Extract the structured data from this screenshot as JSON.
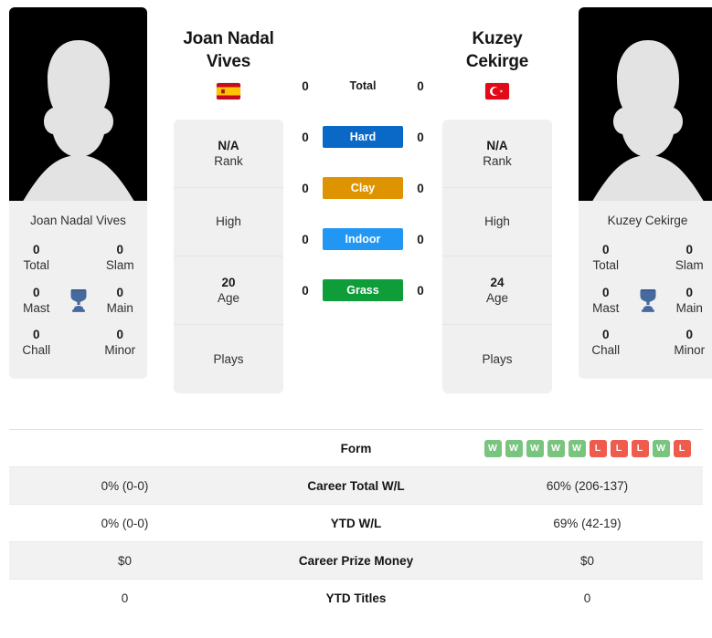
{
  "players": {
    "left": {
      "name": "Joan Nadal Vives",
      "display_name_lines": [
        "Joan Nadal",
        "Vives"
      ],
      "country": "Spain",
      "flag_icon": "flag-spain",
      "avatar_icon": "player-silhouette-avatar",
      "trophies": [
        {
          "num": "0",
          "label": "Total"
        },
        {
          "num": "0",
          "label": "Slam"
        },
        {
          "num": "0",
          "label": "Mast"
        },
        {
          "num": "0",
          "label": "Main"
        },
        {
          "num": "0",
          "label": "Chall"
        },
        {
          "num": "0",
          "label": "Minor"
        }
      ],
      "info": [
        {
          "value": "N/A",
          "label": "Rank"
        },
        {
          "value": "",
          "label": "High"
        },
        {
          "value": "20",
          "label": "Age"
        },
        {
          "value": "",
          "label": "Plays"
        }
      ]
    },
    "right": {
      "name": "Kuzey Cekirge",
      "display_name_lines": [
        "Kuzey",
        "Cekirge"
      ],
      "country": "Turkey",
      "flag_icon": "flag-turkey",
      "avatar_icon": "player-silhouette-avatar",
      "trophies": [
        {
          "num": "0",
          "label": "Total"
        },
        {
          "num": "0",
          "label": "Slam"
        },
        {
          "num": "0",
          "label": "Mast"
        },
        {
          "num": "0",
          "label": "Main"
        },
        {
          "num": "0",
          "label": "Chall"
        },
        {
          "num": "0",
          "label": "Minor"
        }
      ],
      "info": [
        {
          "value": "N/A",
          "label": "Rank"
        },
        {
          "value": "",
          "label": "High"
        },
        {
          "value": "24",
          "label": "Age"
        },
        {
          "value": "",
          "label": "Plays"
        }
      ]
    }
  },
  "trophy_icon": "trophy-icon",
  "h2h": {
    "rows": [
      {
        "surface": "Total",
        "left": "0",
        "right": "0",
        "color": "",
        "style": "plain"
      },
      {
        "surface": "Hard",
        "left": "0",
        "right": "0",
        "color": "#0a69c7",
        "style": "filled"
      },
      {
        "surface": "Clay",
        "left": "0",
        "right": "0",
        "color": "#dd9400",
        "style": "filled"
      },
      {
        "surface": "Indoor",
        "left": "0",
        "right": "0",
        "color": "#2196f3",
        "style": "filled"
      },
      {
        "surface": "Grass",
        "left": "0",
        "right": "0",
        "color": "#0f9d3a",
        "style": "filled"
      }
    ]
  },
  "stats_table": {
    "rows": [
      {
        "label": "Form",
        "type": "form",
        "left": "",
        "right_form": [
          "W",
          "W",
          "W",
          "W",
          "W",
          "L",
          "L",
          "L",
          "W",
          "L"
        ],
        "alt": false
      },
      {
        "label": "Career Total W/L",
        "type": "text",
        "left": "0% (0-0)",
        "right": "60% (206-137)",
        "alt": true
      },
      {
        "label": "YTD W/L",
        "type": "text",
        "left": "0% (0-0)",
        "right": "69% (42-19)",
        "alt": false
      },
      {
        "label": "Career Prize Money",
        "type": "text",
        "left": "$0",
        "right": "$0",
        "alt": true
      },
      {
        "label": "YTD Titles",
        "type": "text",
        "left": "0",
        "right": "0",
        "alt": false
      }
    ],
    "form_colors": {
      "W": "#79c47e",
      "L": "#ef5b4c"
    }
  }
}
